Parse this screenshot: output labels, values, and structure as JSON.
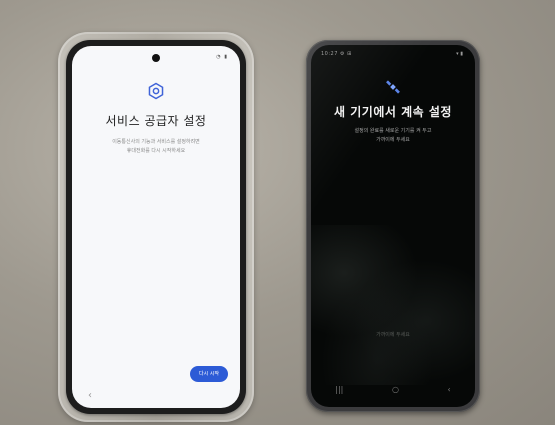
{
  "left_phone": {
    "status_icons": "◔ ▮",
    "icon": "gear-icon",
    "title": "서비스 공급자 설정",
    "description_line1": "이동통신사의 기능과 서비스를 설정하려면",
    "description_line2": "휴대전화를 다시 시작하세요",
    "button_label": "다시 시작",
    "back_glyph": "‹",
    "accent_color": "#2d5bd6"
  },
  "right_phone": {
    "status_left": "10:27 ⚙ ⊞",
    "status_right": "▾ ▮",
    "icon": "satellite-icon",
    "title": "새 기기에서 계속 설정",
    "description_line1": "설정의 완료를 새로운 기기를 켜 두고",
    "description_line2": "가까이에 두세요",
    "lower_text": "가까이에 두세요",
    "nav_glyphs": [
      "|||",
      "○",
      "‹"
    ]
  }
}
